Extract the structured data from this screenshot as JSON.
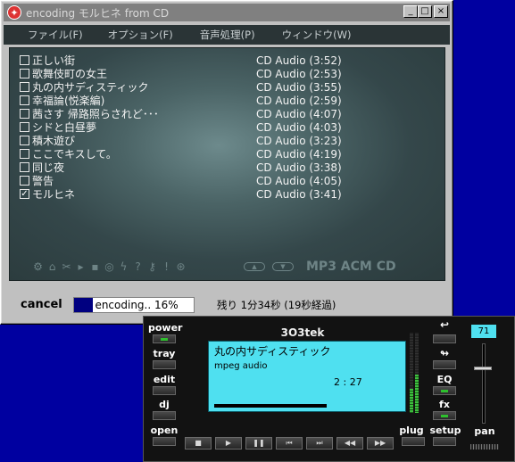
{
  "encoder": {
    "title": "encoding モルヒネ from CD",
    "window_controls": {
      "minimize": "_",
      "maximize": "□",
      "close": "×"
    },
    "menu": [
      "ファイル(F)",
      "オプション(F)",
      "音声処理(P)",
      "ウィンドウ(W)"
    ],
    "tracks": [
      {
        "name": "正しい街",
        "info": "CD Audio (3:52)",
        "checked": false
      },
      {
        "name": "歌舞伎町の女王",
        "info": "CD Audio (2:53)",
        "checked": false
      },
      {
        "name": "丸の内サディスティック",
        "info": "CD Audio (3:55)",
        "checked": false
      },
      {
        "name": "幸福論(悦楽編)",
        "info": "CD Audio (2:59)",
        "checked": false
      },
      {
        "name": "茜さす 帰路照らされど･･･",
        "info": "CD Audio (4:07)",
        "checked": false
      },
      {
        "name": "シドと白昼夢",
        "info": "CD Audio (4:03)",
        "checked": false
      },
      {
        "name": "積木遊び",
        "info": "CD Audio (3:23)",
        "checked": false
      },
      {
        "name": "ここでキスして。",
        "info": "CD Audio (4:19)",
        "checked": false
      },
      {
        "name": "同じ夜",
        "info": "CD Audio (3:38)",
        "checked": false
      },
      {
        "name": "警告",
        "info": "CD Audio (4:05)",
        "checked": false
      },
      {
        "name": "モルヒネ",
        "info": "CD Audio (3:41)",
        "checked": true
      }
    ],
    "tool_icons": [
      "settings-icon",
      "open-folder-icon",
      "scissors-icon",
      "play-icon",
      "stop-icon",
      "cd-icon",
      "lightning-icon",
      "help-icon",
      "key-icon",
      "thermometer-icon",
      "logo-icon"
    ],
    "nav_up": "▲",
    "nav_down": "▼",
    "brand_text": "MP3 ACM CD",
    "cancel_label": "cancel",
    "progress_text": "encoding.. 16%",
    "progress_value": 0.16,
    "remaining_text": "残り 1分34秒 (19秒経過)"
  },
  "player": {
    "logo": "3O3tek",
    "left_buttons": [
      "power",
      "tray",
      "edit",
      "dj",
      "open"
    ],
    "right_buttons": [
      "↩",
      "↬",
      "EQ",
      "fx",
      "setup"
    ],
    "right_top_arrow": "⇆",
    "plug_label": "plug",
    "pan_label": "pan",
    "volume_value": "71",
    "screen": {
      "title": "丸の内サディスティック",
      "format": "mpeg audio",
      "time": "2 : 27"
    },
    "transport": [
      "■",
      "▶",
      "❚❚",
      "⏮",
      "⏭",
      "◀◀",
      "▶▶"
    ]
  }
}
